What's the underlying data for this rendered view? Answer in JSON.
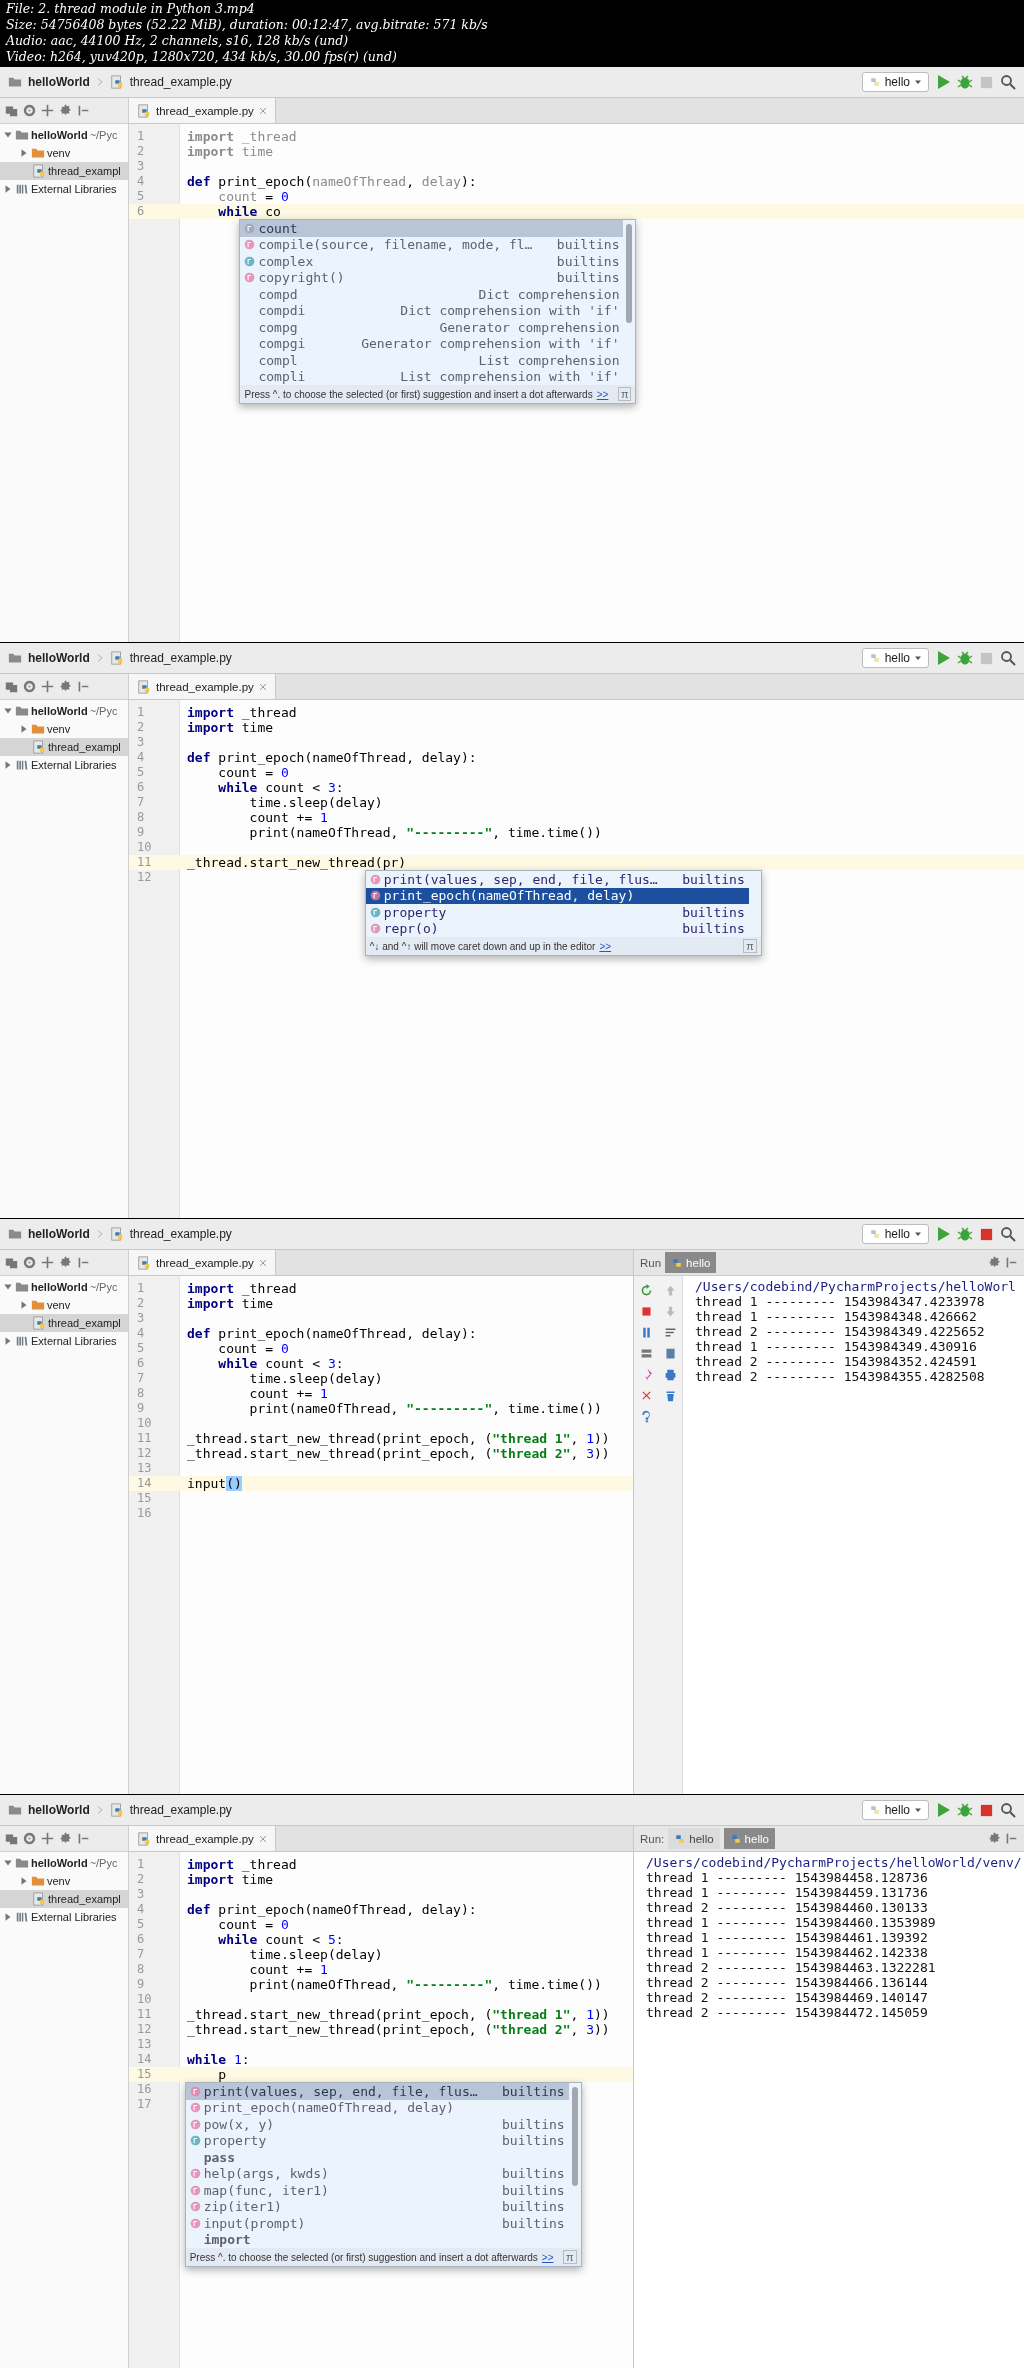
{
  "header": {
    "lines": [
      "File: 2. thread module in Python 3.mp4",
      "Size: 54756408 bytes (52.22 MiB), duration: 00:12:47, avg.bitrate: 571 kb/s",
      "Audio: aac, 44100 Hz, 2 channels, s16, 128 kb/s (und)",
      "Video: h264, yuv420p, 1280x720, 434 kb/s, 30.00 fps(r) (und)"
    ]
  },
  "frames": [
    {
      "breadcrumb": {
        "project": "helloWorld",
        "file": "thread_example.py"
      },
      "run_config": "hello",
      "stop_enabled": false,
      "tree": [
        {
          "kind": "project",
          "label": "helloWorld",
          "path": "~/Pyc",
          "expanded": true,
          "selected": false,
          "children": [
            {
              "kind": "folder",
              "label": "venv",
              "expanded": false,
              "selected": false
            },
            {
              "kind": "file",
              "label": "thread_exampl",
              "selected": true
            }
          ]
        },
        {
          "kind": "library",
          "label": "External Libraries",
          "expanded": false,
          "selected": false
        }
      ],
      "tab": {
        "label": "thread_example.py",
        "selected": true
      },
      "code": [
        {
          "number": "1",
          "current": false,
          "tokens": [
            {
              "kind": "kwdim",
              "text": "import"
            },
            {
              "kind": "dim",
              "text": " _thread"
            }
          ]
        },
        {
          "number": "2",
          "current": false,
          "tokens": [
            {
              "kind": "kwdim",
              "text": "import"
            },
            {
              "kind": "dim",
              "text": " time"
            }
          ]
        },
        {
          "number": "3",
          "current": false
        },
        {
          "number": "4",
          "current": false,
          "tokens": [
            {
              "kind": "kw",
              "text": "def"
            },
            {
              "kind": "id",
              "text": " print_epoch("
            },
            {
              "kind": "dim",
              "text": "nameOfThread"
            },
            {
              "kind": "id",
              "text": ", "
            },
            {
              "kind": "dim",
              "text": "delay"
            },
            {
              "kind": "id",
              "text": "):"
            }
          ]
        },
        {
          "number": "5",
          "current": false,
          "tokens": [
            {
              "kind": "dim",
              "text": "    count"
            },
            {
              "kind": "id",
              "text": " = "
            },
            {
              "kind": "num",
              "text": "0"
            }
          ]
        },
        {
          "number": "6",
          "current": true,
          "tokens": [
            {
              "kind": "kw",
              "text": "    while"
            },
            {
              "kind": "id",
              "text": " co"
            }
          ]
        }
      ],
      "completion": {
        "active": false,
        "hint": "Press ^. to choose the selected (or first) suggestion and insert a dot afterwards",
        "link": ">>",
        "corner": "π",
        "items": [
          {
            "kind": "variable",
            "name": "count",
            "selected": true
          },
          {
            "kind": "function",
            "name": "compile(source, filename, mode, fl…",
            "type": "builtins",
            "selected": false
          },
          {
            "kind": "class",
            "name": "complex",
            "type": "builtins",
            "selected": false
          },
          {
            "kind": "function",
            "name": "copyright()",
            "type": "builtins",
            "selected": false
          },
          {
            "kind": "template",
            "name": "compd",
            "type": "Dict comprehension",
            "selected": false
          },
          {
            "kind": "template",
            "name": "compdi",
            "type": "Dict comprehension with 'if'",
            "selected": false
          },
          {
            "kind": "template",
            "name": "compg",
            "type": "Generator comprehension",
            "selected": false
          },
          {
            "kind": "template",
            "name": "compgi",
            "type": "Generator comprehension with 'if'",
            "selected": false
          },
          {
            "kind": "template",
            "name": "compl",
            "type": "List comprehension",
            "selected": false
          },
          {
            "kind": "template",
            "name": "compli",
            "type": "List comprehension with 'if'",
            "selected": false
          }
        ]
      }
    },
    {
      "breadcrumb": {
        "project": "helloWorld",
        "file": "thread_example.py"
      },
      "run_config": "hello",
      "stop_enabled": false,
      "tree": [
        {
          "kind": "project",
          "label": "helloWorld",
          "path": "~/Pyc",
          "expanded": true,
          "selected": false,
          "children": [
            {
              "kind": "folder",
              "label": "venv",
              "expanded": false,
              "selected": false
            },
            {
              "kind": "file",
              "label": "thread_exampl",
              "selected": true
            }
          ]
        },
        {
          "kind": "library",
          "label": "External Libraries",
          "expanded": false,
          "selected": false
        }
      ],
      "tab": {
        "label": "thread_example.py",
        "selected": true
      },
      "code": [
        {
          "number": "1",
          "current": false,
          "tokens": [
            {
              "kind": "kw",
              "text": "import"
            },
            {
              "kind": "id",
              "text": " _thread"
            }
          ]
        },
        {
          "number": "2",
          "current": false,
          "tokens": [
            {
              "kind": "kw",
              "text": "import"
            },
            {
              "kind": "id",
              "text": " time"
            }
          ]
        },
        {
          "number": "3",
          "current": false
        },
        {
          "number": "4",
          "current": false,
          "tokens": [
            {
              "kind": "kw",
              "text": "def"
            },
            {
              "kind": "id",
              "text": " print_epoch(nameOfThread, delay):"
            }
          ]
        },
        {
          "number": "5",
          "current": false,
          "tokens": [
            {
              "kind": "id",
              "text": "    count = "
            },
            {
              "kind": "num",
              "text": "0"
            }
          ]
        },
        {
          "number": "6",
          "current": false,
          "tokens": [
            {
              "kind": "kw",
              "text": "    while"
            },
            {
              "kind": "id",
              "text": " count < "
            },
            {
              "kind": "num",
              "text": "3"
            },
            {
              "kind": "id",
              "text": ":"
            }
          ]
        },
        {
          "number": "7",
          "current": false,
          "tokens": [
            {
              "kind": "id",
              "text": "        time.sleep(delay)"
            }
          ]
        },
        {
          "number": "8",
          "current": false,
          "tokens": [
            {
              "kind": "id",
              "text": "        count += "
            },
            {
              "kind": "num",
              "text": "1"
            }
          ]
        },
        {
          "number": "9",
          "current": false,
          "tokens": [
            {
              "kind": "id",
              "text": "        print(nameOfThread, "
            },
            {
              "kind": "str",
              "text": "\"---------\""
            },
            {
              "kind": "id",
              "text": ", time.time())"
            }
          ]
        },
        {
          "number": "10",
          "current": false
        },
        {
          "number": "11",
          "current": true,
          "tokens": [
            {
              "kind": "id",
              "text": "_thread.start_new_thread(pr)"
            }
          ]
        },
        {
          "number": "12",
          "current": false
        }
      ],
      "completion": {
        "active": true,
        "hint": "^↓ and ^↑ will move caret down and up in the editor",
        "link": ">>",
        "corner": "π",
        "items": [
          {
            "kind": "function",
            "name": "print(values, sep, end, file, flus…",
            "type": "builtins",
            "selected": false
          },
          {
            "kind": "function",
            "name": "print_epoch(nameOfThread, delay)",
            "selected": true
          },
          {
            "kind": "class",
            "name": "property",
            "type": "builtins",
            "selected": false
          },
          {
            "kind": "function",
            "name": "repr(o)",
            "type": "builtins",
            "selected": false
          }
        ]
      }
    },
    {
      "breadcrumb": {
        "project": "helloWorld",
        "file": "thread_example.py"
      },
      "run_config": "hello",
      "stop_enabled": true,
      "tree": [
        {
          "kind": "project",
          "label": "helloWorld",
          "path": "~/Pyc",
          "expanded": true,
          "selected": false,
          "children": [
            {
              "kind": "folder",
              "label": "venv",
              "expanded": false,
              "selected": false
            },
            {
              "kind": "file",
              "label": "thread_exampl",
              "selected": true
            }
          ]
        },
        {
          "kind": "library",
          "label": "External Libraries",
          "expanded": false,
          "selected": false
        }
      ],
      "tab": {
        "label": "thread_example.py",
        "selected": true
      },
      "code": [
        {
          "number": "1",
          "current": false,
          "tokens": [
            {
              "kind": "kw",
              "text": "import"
            },
            {
              "kind": "id",
              "text": " _thread"
            }
          ]
        },
        {
          "number": "2",
          "current": false,
          "tokens": [
            {
              "kind": "kw",
              "text": "import"
            },
            {
              "kind": "id",
              "text": " time"
            }
          ]
        },
        {
          "number": "3",
          "current": false
        },
        {
          "number": "4",
          "current": false,
          "tokens": [
            {
              "kind": "kw",
              "text": "def"
            },
            {
              "kind": "id",
              "text": " print_epoch(nameOfThread, delay):"
            }
          ]
        },
        {
          "number": "5",
          "current": false,
          "tokens": [
            {
              "kind": "id",
              "text": "    count = "
            },
            {
              "kind": "num",
              "text": "0"
            }
          ]
        },
        {
          "number": "6",
          "current": false,
          "tokens": [
            {
              "kind": "kw",
              "text": "    while"
            },
            {
              "kind": "id",
              "text": " count < "
            },
            {
              "kind": "num",
              "text": "3"
            },
            {
              "kind": "id",
              "text": ":"
            }
          ]
        },
        {
          "number": "7",
          "current": false,
          "tokens": [
            {
              "kind": "id",
              "text": "        time.sleep(delay)"
            }
          ]
        },
        {
          "number": "8",
          "current": false,
          "tokens": [
            {
              "kind": "id",
              "text": "        count += "
            },
            {
              "kind": "num",
              "text": "1"
            }
          ]
        },
        {
          "number": "9",
          "current": false,
          "tokens": [
            {
              "kind": "id",
              "text": "        print(nameOfThread, "
            },
            {
              "kind": "str",
              "text": "\"---------\""
            },
            {
              "kind": "id",
              "text": ", time.time())"
            }
          ]
        },
        {
          "number": "10",
          "current": false
        },
        {
          "number": "11",
          "current": false,
          "tokens": [
            {
              "kind": "id",
              "text": "_thread.start_new_thread(print_epoch, ("
            },
            {
              "kind": "str",
              "text": "\"thread 1\""
            },
            {
              "kind": "id",
              "text": ", "
            },
            {
              "kind": "num",
              "text": "1"
            },
            {
              "kind": "id",
              "text": "))"
            }
          ]
        },
        {
          "number": "12",
          "current": false,
          "tokens": [
            {
              "kind": "id",
              "text": "_thread.start_new_thread(print_epoch, ("
            },
            {
              "kind": "str",
              "text": "\"thread 2\""
            },
            {
              "kind": "id",
              "text": ", "
            },
            {
              "kind": "num",
              "text": "3"
            },
            {
              "kind": "id",
              "text": "))"
            }
          ]
        },
        {
          "number": "13",
          "current": false
        },
        {
          "number": "14",
          "current": true,
          "tokens": [
            {
              "kind": "id",
              "text": "input"
            },
            {
              "kind": "match",
              "text": "()"
            }
          ]
        },
        {
          "number": "15",
          "current": false
        },
        {
          "number": "16",
          "current": false
        }
      ],
      "run_panel": {
        "label": "Run",
        "toolbar": true,
        "tabs": [
          {
            "label": "hello",
            "selected": true
          }
        ],
        "output": [
          {
            "kind": "path",
            "text": "/Users/codebind/PycharmProjects/helloWorl"
          },
          {
            "kind": "line",
            "text": "thread 1 --------- 1543984347.4233978"
          },
          {
            "kind": "line",
            "text": "thread 1 --------- 1543984348.426662"
          },
          {
            "kind": "line",
            "text": "thread 2 --------- 1543984349.4225652"
          },
          {
            "kind": "line",
            "text": "thread 1 --------- 1543984349.430916"
          },
          {
            "kind": "line",
            "text": "thread 2 --------- 1543984352.424591"
          },
          {
            "kind": "line",
            "text": "thread 2 --------- 1543984355.4282508"
          }
        ]
      }
    },
    {
      "breadcrumb": {
        "project": "helloWorld",
        "file": "thread_example.py"
      },
      "run_config": "hello",
      "stop_enabled": true,
      "tree": [
        {
          "kind": "project",
          "label": "helloWorld",
          "path": "~/Pyc",
          "expanded": true,
          "selected": false,
          "children": [
            {
              "kind": "folder",
              "label": "venv",
              "expanded": false,
              "selected": false
            },
            {
              "kind": "file",
              "label": "thread_exampl",
              "selected": true
            }
          ]
        },
        {
          "kind": "library",
          "label": "External Libraries",
          "expanded": false,
          "selected": false
        }
      ],
      "tab": {
        "label": "thread_example.py",
        "selected": true
      },
      "code": [
        {
          "number": "1",
          "current": false,
          "tokens": [
            {
              "kind": "kw",
              "text": "import"
            },
            {
              "kind": "id",
              "text": " _thread"
            }
          ]
        },
        {
          "number": "2",
          "current": false,
          "tokens": [
            {
              "kind": "kw",
              "text": "import"
            },
            {
              "kind": "id",
              "text": " time"
            }
          ]
        },
        {
          "number": "3",
          "current": false
        },
        {
          "number": "4",
          "current": false,
          "tokens": [
            {
              "kind": "kw",
              "text": "def"
            },
            {
              "kind": "id",
              "text": " print_epoch(nameOfThread, delay):"
            }
          ]
        },
        {
          "number": "5",
          "current": false,
          "tokens": [
            {
              "kind": "id",
              "text": "    count = "
            },
            {
              "kind": "num",
              "text": "0"
            }
          ]
        },
        {
          "number": "6",
          "current": false,
          "tokens": [
            {
              "kind": "kw",
              "text": "    while"
            },
            {
              "kind": "id",
              "text": " count < "
            },
            {
              "kind": "num",
              "text": "5"
            },
            {
              "kind": "id",
              "text": ":"
            }
          ]
        },
        {
          "number": "7",
          "current": false,
          "tokens": [
            {
              "kind": "id",
              "text": "        time.sleep(delay)"
            }
          ]
        },
        {
          "number": "8",
          "current": false,
          "tokens": [
            {
              "kind": "id",
              "text": "        count += "
            },
            {
              "kind": "num",
              "text": "1"
            }
          ]
        },
        {
          "number": "9",
          "current": false,
          "tokens": [
            {
              "kind": "id",
              "text": "        print(nameOfThread, "
            },
            {
              "kind": "str",
              "text": "\"---------\""
            },
            {
              "kind": "id",
              "text": ", time.time())"
            }
          ]
        },
        {
          "number": "10",
          "current": false
        },
        {
          "number": "11",
          "current": false,
          "tokens": [
            {
              "kind": "id",
              "text": "_thread.start_new_thread(print_epoch, ("
            },
            {
              "kind": "str",
              "text": "\"thread 1\""
            },
            {
              "kind": "id",
              "text": ", "
            },
            {
              "kind": "num",
              "text": "1"
            },
            {
              "kind": "id",
              "text": "))"
            }
          ]
        },
        {
          "number": "12",
          "current": false,
          "tokens": [
            {
              "kind": "id",
              "text": "_thread.start_new_thread(print_epoch, ("
            },
            {
              "kind": "str",
              "text": "\"thread 2\""
            },
            {
              "kind": "id",
              "text": ", "
            },
            {
              "kind": "num",
              "text": "3"
            },
            {
              "kind": "id",
              "text": "))"
            }
          ]
        },
        {
          "number": "13",
          "current": false
        },
        {
          "number": "14",
          "current": false,
          "tokens": [
            {
              "kind": "kw",
              "text": "while"
            },
            {
              "kind": "num",
              "text": " 1"
            },
            {
              "kind": "id",
              "text": ":"
            }
          ]
        },
        {
          "number": "15",
          "current": true,
          "tokens": [
            {
              "kind": "id",
              "text": "    p"
            }
          ]
        },
        {
          "number": "16",
          "current": false
        },
        {
          "number": "17",
          "current": false
        }
      ],
      "completion": {
        "active": false,
        "hint": "Press ^. to choose the selected (or first) suggestion and insert a dot afterwards",
        "link": ">>",
        "corner": "π",
        "items": [
          {
            "kind": "function",
            "name": "print(values, sep, end, file, flus…",
            "type": "builtins",
            "selected": true
          },
          {
            "kind": "function",
            "name": "print_epoch(nameOfThread, delay)",
            "selected": false
          },
          {
            "kind": "function",
            "name": "pow(x, y)",
            "type": "builtins",
            "selected": false
          },
          {
            "kind": "class",
            "name": "property",
            "type": "builtins",
            "selected": false
          },
          {
            "kind": "keyword",
            "name": "pass",
            "selected": false
          },
          {
            "kind": "function",
            "name": "help(args, kwds)",
            "type": "builtins",
            "selected": false
          },
          {
            "kind": "function",
            "name": "map(func, iter1)",
            "type": "builtins",
            "selected": false
          },
          {
            "kind": "function",
            "name": "zip(iter1)",
            "type": "builtins",
            "selected": false
          },
          {
            "kind": "function",
            "name": "input(prompt)",
            "type": "builtins",
            "selected": false
          },
          {
            "kind": "keyword",
            "name": "import",
            "selected": false
          }
        ]
      },
      "run_panel": {
        "label": "Run:",
        "toolbar": false,
        "tabs": [
          {
            "label": "hello",
            "selected": false
          },
          {
            "label": "hello",
            "selected": true
          }
        ],
        "output": [
          {
            "kind": "path",
            "text": "/Users/codebind/PycharmProjects/helloWorld/venv/"
          },
          {
            "kind": "line",
            "text": "thread 1 --------- 1543984458.128736"
          },
          {
            "kind": "line",
            "text": "thread 1 --------- 1543984459.131736"
          },
          {
            "kind": "line",
            "text": "thread 2 --------- 1543984460.130133"
          },
          {
            "kind": "line",
            "text": "thread 1 --------- 1543984460.1353989"
          },
          {
            "kind": "line",
            "text": "thread 1 --------- 1543984461.139392"
          },
          {
            "kind": "line",
            "text": "thread 1 --------- 1543984462.142338"
          },
          {
            "kind": "line",
            "text": "thread 2 --------- 1543984463.1322281"
          },
          {
            "kind": "line",
            "text": "thread 2 --------- 1543984466.136144"
          },
          {
            "kind": "line",
            "text": "thread 2 --------- 1543984469.140147"
          },
          {
            "kind": "line",
            "text": "thread 2 --------- 1543984472.145059"
          }
        ]
      }
    }
  ]
}
